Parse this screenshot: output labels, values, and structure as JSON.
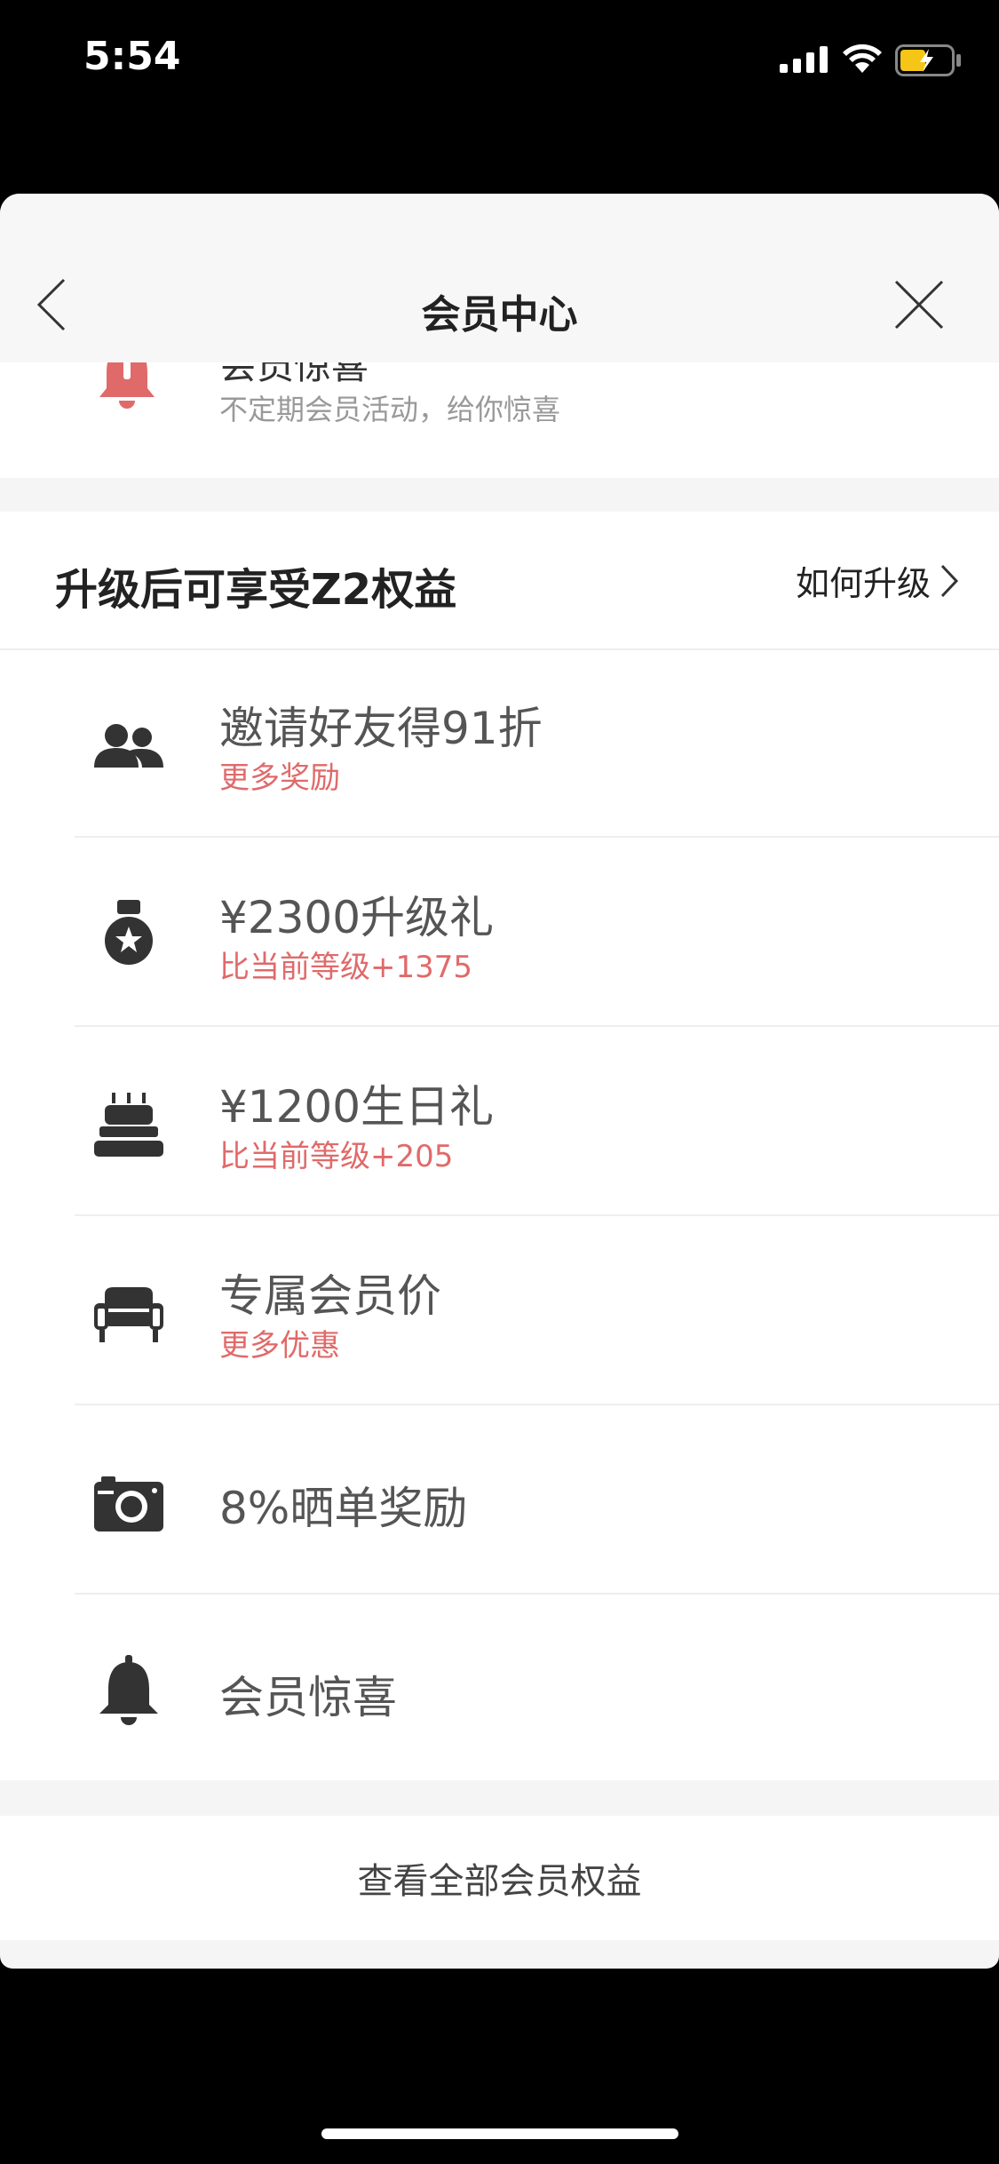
{
  "status": {
    "time": "5:54"
  },
  "nav": {
    "title": "会员中心"
  },
  "previous_item": {
    "title": "会员惊喜",
    "subtitle": "不定期会员活动，给你惊喜"
  },
  "benefits": {
    "title": "升级后可享受Z2权益",
    "how_upgrade": "如何升级",
    "items": [
      {
        "title": "邀请好友得91折",
        "subtitle": "更多奖励",
        "icon": "users-icon"
      },
      {
        "title": "¥2300升级礼",
        "subtitle": "比当前等级+1375",
        "icon": "medal-icon"
      },
      {
        "title": "¥1200生日礼",
        "subtitle": "比当前等级+205",
        "icon": "cake-icon"
      },
      {
        "title": "专属会员价",
        "subtitle": "更多优惠",
        "icon": "sofa-icon"
      },
      {
        "title": "8%晒单奖励",
        "subtitle": "",
        "icon": "camera-icon"
      },
      {
        "title": "会员惊喜",
        "subtitle": "",
        "icon": "bell-icon"
      }
    ]
  },
  "view_all": "查看全部会员权益",
  "colors": {
    "accent": "#e06a6a",
    "background": "#f5f5f5",
    "text_primary": "#222222",
    "text_secondary": "#999999"
  }
}
